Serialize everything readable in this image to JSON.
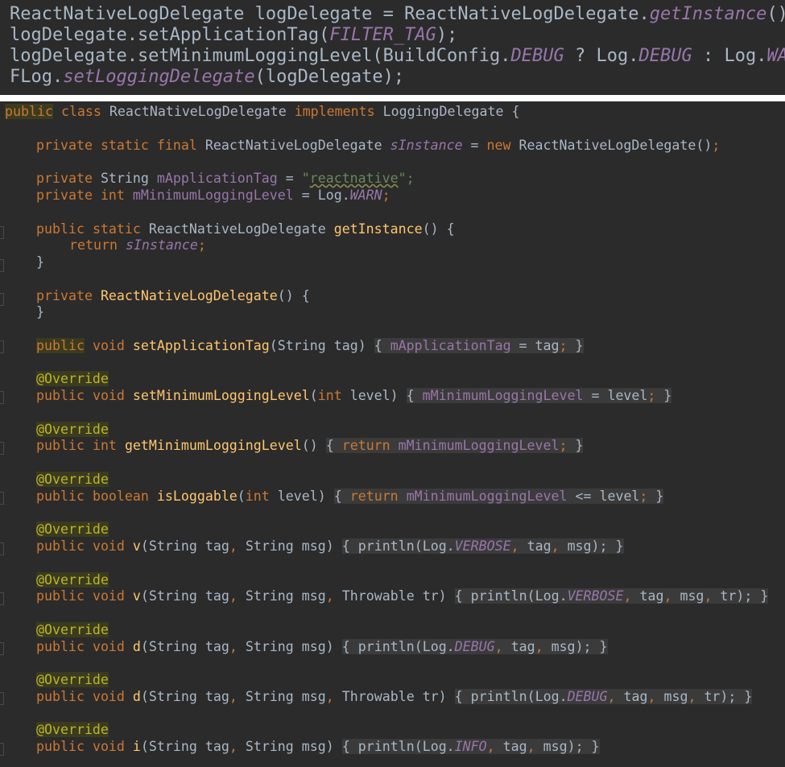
{
  "snippet": {
    "line1": {
      "type1": "ReactNativeLogDelegate",
      "var1": " logDelegate = ",
      "cls1": "ReactNativeLogDelegate.",
      "call1": "getInstance",
      "end1": "();"
    },
    "line2": {
      "pre": "logDelegate.setApplicationTag(",
      "const": "FILTER_TAG",
      "end": ");"
    },
    "line3": {
      "pre": "logDelegate.setMinimumLoggingLevel(BuildConfig.",
      "c1": "DEBUG",
      "mid": " ? Log.",
      "c2": "DEBUG",
      "mid2": " : Log.",
      "c3": "WARN",
      "end": ");"
    },
    "line4": {
      "pre": "FLog.",
      "call": "setLoggingDelegate",
      "end": "(logDelegate);"
    }
  },
  "code": {
    "kw_public": "public",
    "kw_class": "class",
    "kw_implements": "implements",
    "kw_private": "private",
    "kw_static": "static",
    "kw_final": "final",
    "kw_new": "new",
    "kw_return": "return",
    "kw_int": "int",
    "kw_void": "void",
    "kw_boolean": "boolean",
    "annotation": "@Override",
    "class_name": "ReactNativeLogDelegate",
    "interface_name": "LoggingDelegate",
    "open_brace": " {",
    "close_brace": "}",
    "s_instance": "sInstance",
    "m_app_tag": "mApplicationTag",
    "m_min_level": "mMinimumLoggingLevel",
    "string_value": "reactnative",
    "const_warn": "WARN",
    "const_verbose": "VERBOSE",
    "const_debug": "DEBUG",
    "const_info": "INFO",
    "m_getInstance": "getInstance",
    "m_setApplicationTag": "setApplicationTag",
    "m_setMinimumLoggingLevel": "setMinimumLoggingLevel",
    "m_getMinimumLoggingLevel": "getMinimumLoggingLevel",
    "m_isLoggable": "isLoggable",
    "m_v": "v",
    "m_d": "d",
    "m_i": "i",
    "t_String": "String",
    "t_Throwable": "Throwable",
    "p_tag": "tag",
    "p_msg": "msg",
    "p_tr": "tr",
    "p_level": "level",
    "println": "println",
    "log_dot": "(Log.",
    "log_warn_prefix": "Log.",
    "lbrace": "{",
    "rbrace": "}",
    "rbrace_spaced": " }",
    "semi": ";",
    "comma": ", ",
    "lparen": "(",
    "rparen": ")",
    "paren_pair": "()",
    "close_call": ");",
    "assign": " = ",
    "le": " <= ",
    "open_quote": "\"",
    "close_quote_semi": "\";"
  }
}
